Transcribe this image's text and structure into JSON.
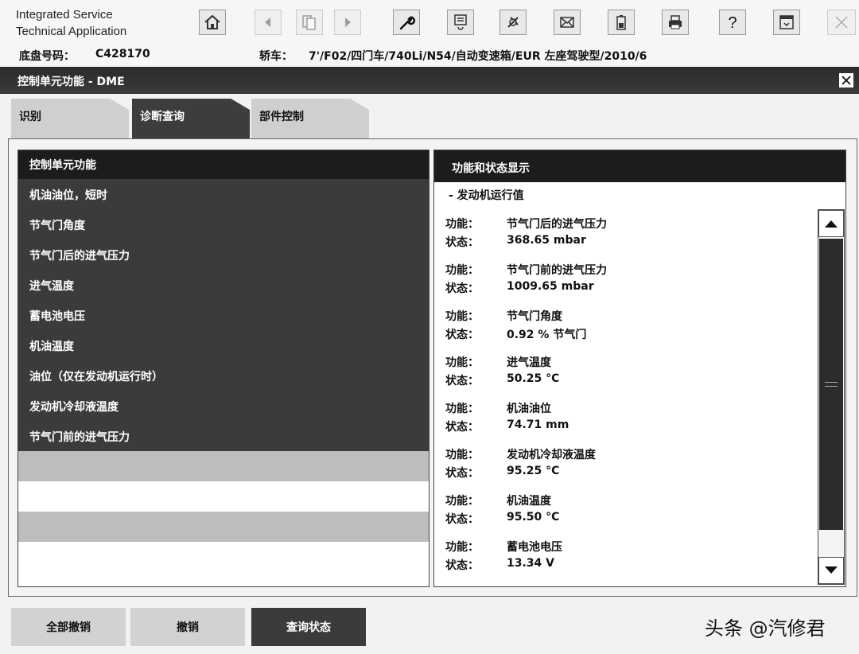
{
  "app": {
    "title_line1": "Integrated Service",
    "title_line2": "Technical Application"
  },
  "toolbar": {
    "icons": [
      "home-icon",
      "back-icon",
      "pages-icon",
      "forward-icon",
      "wrench-icon",
      "checklist-icon",
      "plug-icon",
      "mail-icon",
      "battery-icon",
      "printer-icon",
      "help-icon",
      "window-icon",
      "close-icon"
    ]
  },
  "vehicle": {
    "chassis_label": "底盘号码：",
    "chassis_value": "C428170",
    "car_label": "轿车：",
    "car_value": "7'/F02/四门车/740Li/N54/自动变速箱/EUR 左座驾驶型/2010/6"
  },
  "window": {
    "title": "控制单元功能 - DME"
  },
  "tabs": [
    {
      "label": "识别"
    },
    {
      "label": "诊断查询"
    },
    {
      "label": "部件控制"
    }
  ],
  "left_panel": {
    "header": "控制单元功能",
    "items": [
      "机油油位，短时",
      "节气门角度",
      "节气门后的进气压力",
      "进气温度",
      "蓄电池电压",
      "机油温度",
      "油位（仅在发动机运行时）",
      "发动机冷却液温度",
      "节气门前的进气压力"
    ]
  },
  "right_panel": {
    "header": "功能和状态显示",
    "section": "- 发动机运行值",
    "function_label": "功能：",
    "status_label": "状态：",
    "entries": [
      {
        "function": "节气门后的进气压力",
        "status": "368.65 mbar"
      },
      {
        "function": "节气门前的进气压力",
        "status": "1009.65 mbar"
      },
      {
        "function": "节气门角度",
        "status": "0.92 % 节气门"
      },
      {
        "function": "进气温度",
        "status": "50.25 °C"
      },
      {
        "function": "机油油位",
        "status": "74.71 mm"
      },
      {
        "function": "发动机冷却液温度",
        "status": "95.25 °C"
      },
      {
        "function": "机油温度",
        "status": "95.50 °C"
      },
      {
        "function": "蓄电池电压",
        "status": "13.34 V"
      }
    ]
  },
  "buttons": {
    "cancel_all": "全部撤销",
    "cancel": "撤销",
    "query_status": "查询状态"
  },
  "watermark": "头条 @汽修君"
}
